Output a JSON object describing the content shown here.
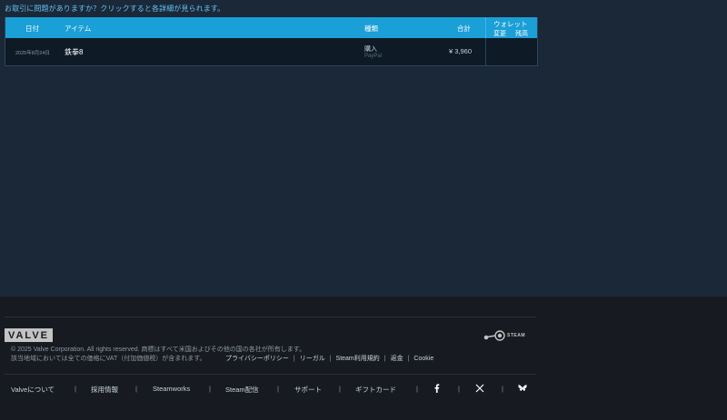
{
  "help": {
    "link_text": "お取引に問題がありますか？クリックすると各詳細が見られます。"
  },
  "table": {
    "headers": {
      "date": "日付",
      "item": "アイテム",
      "type": "種類",
      "total": "合計",
      "wallet": "ウォレット",
      "wallet_change": "変更",
      "wallet_balance": "残高"
    },
    "rows": [
      {
        "date": "2025年8月24日",
        "item": "鉄拳8",
        "type": "購入",
        "method": "PayPal",
        "total": "¥ 3,960",
        "wallet_change": "",
        "wallet_balance": ""
      }
    ]
  },
  "footer": {
    "valve_logo_text": "VALVE",
    "steam_logo_text": "STEAM",
    "copyright": "© 2025 Valve Corporation. All rights reserved. 商標はすべて米国およびその他の国の各社が所有します。",
    "vat_notice": "該当地域においては全ての価格にVAT（付加価値税）が含まれます。",
    "legal_links": [
      "プライバシーポリシー",
      "リーガル",
      "Steam利用規約",
      "返金",
      "Cookie"
    ],
    "nav_links": [
      "Valveについて",
      "採用情報",
      "Steamworks",
      "Steam配信",
      "サポート",
      "ギフトカード"
    ],
    "social": [
      "facebook-icon",
      "x-icon",
      "bluesky-icon"
    ]
  },
  "colors": {
    "background": "#1b2838",
    "header_blue": "#1a9fd7",
    "link_blue": "#66c0f4",
    "footer_bg": "#171a21"
  }
}
